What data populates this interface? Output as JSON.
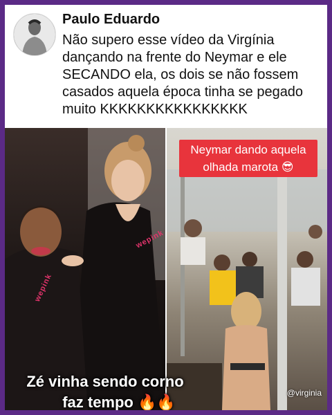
{
  "tweet": {
    "author": "Paulo Eduardo",
    "text": "Não supero esse vídeo da Virgínia dançando na frente do Neymar e ele SECANDO ela, os dois se não fossem casados aquela época tinha se pegado muito KKKKKKKKKKKKKKKK"
  },
  "left_photo": {
    "brand_mark_1": "wepink",
    "brand_mark_2": "wepink",
    "caption_line1": "Zé vinha sendo corno",
    "caption_line2": "faz tempo",
    "caption_emoji": "🔥🔥"
  },
  "right_photo": {
    "label_line1": "Neymar dando aquela",
    "label_line2": "olhada marota 😎",
    "watermark": "@virginia"
  },
  "colors": {
    "border": "#5b2a86",
    "label_bg": "#e8343c"
  }
}
